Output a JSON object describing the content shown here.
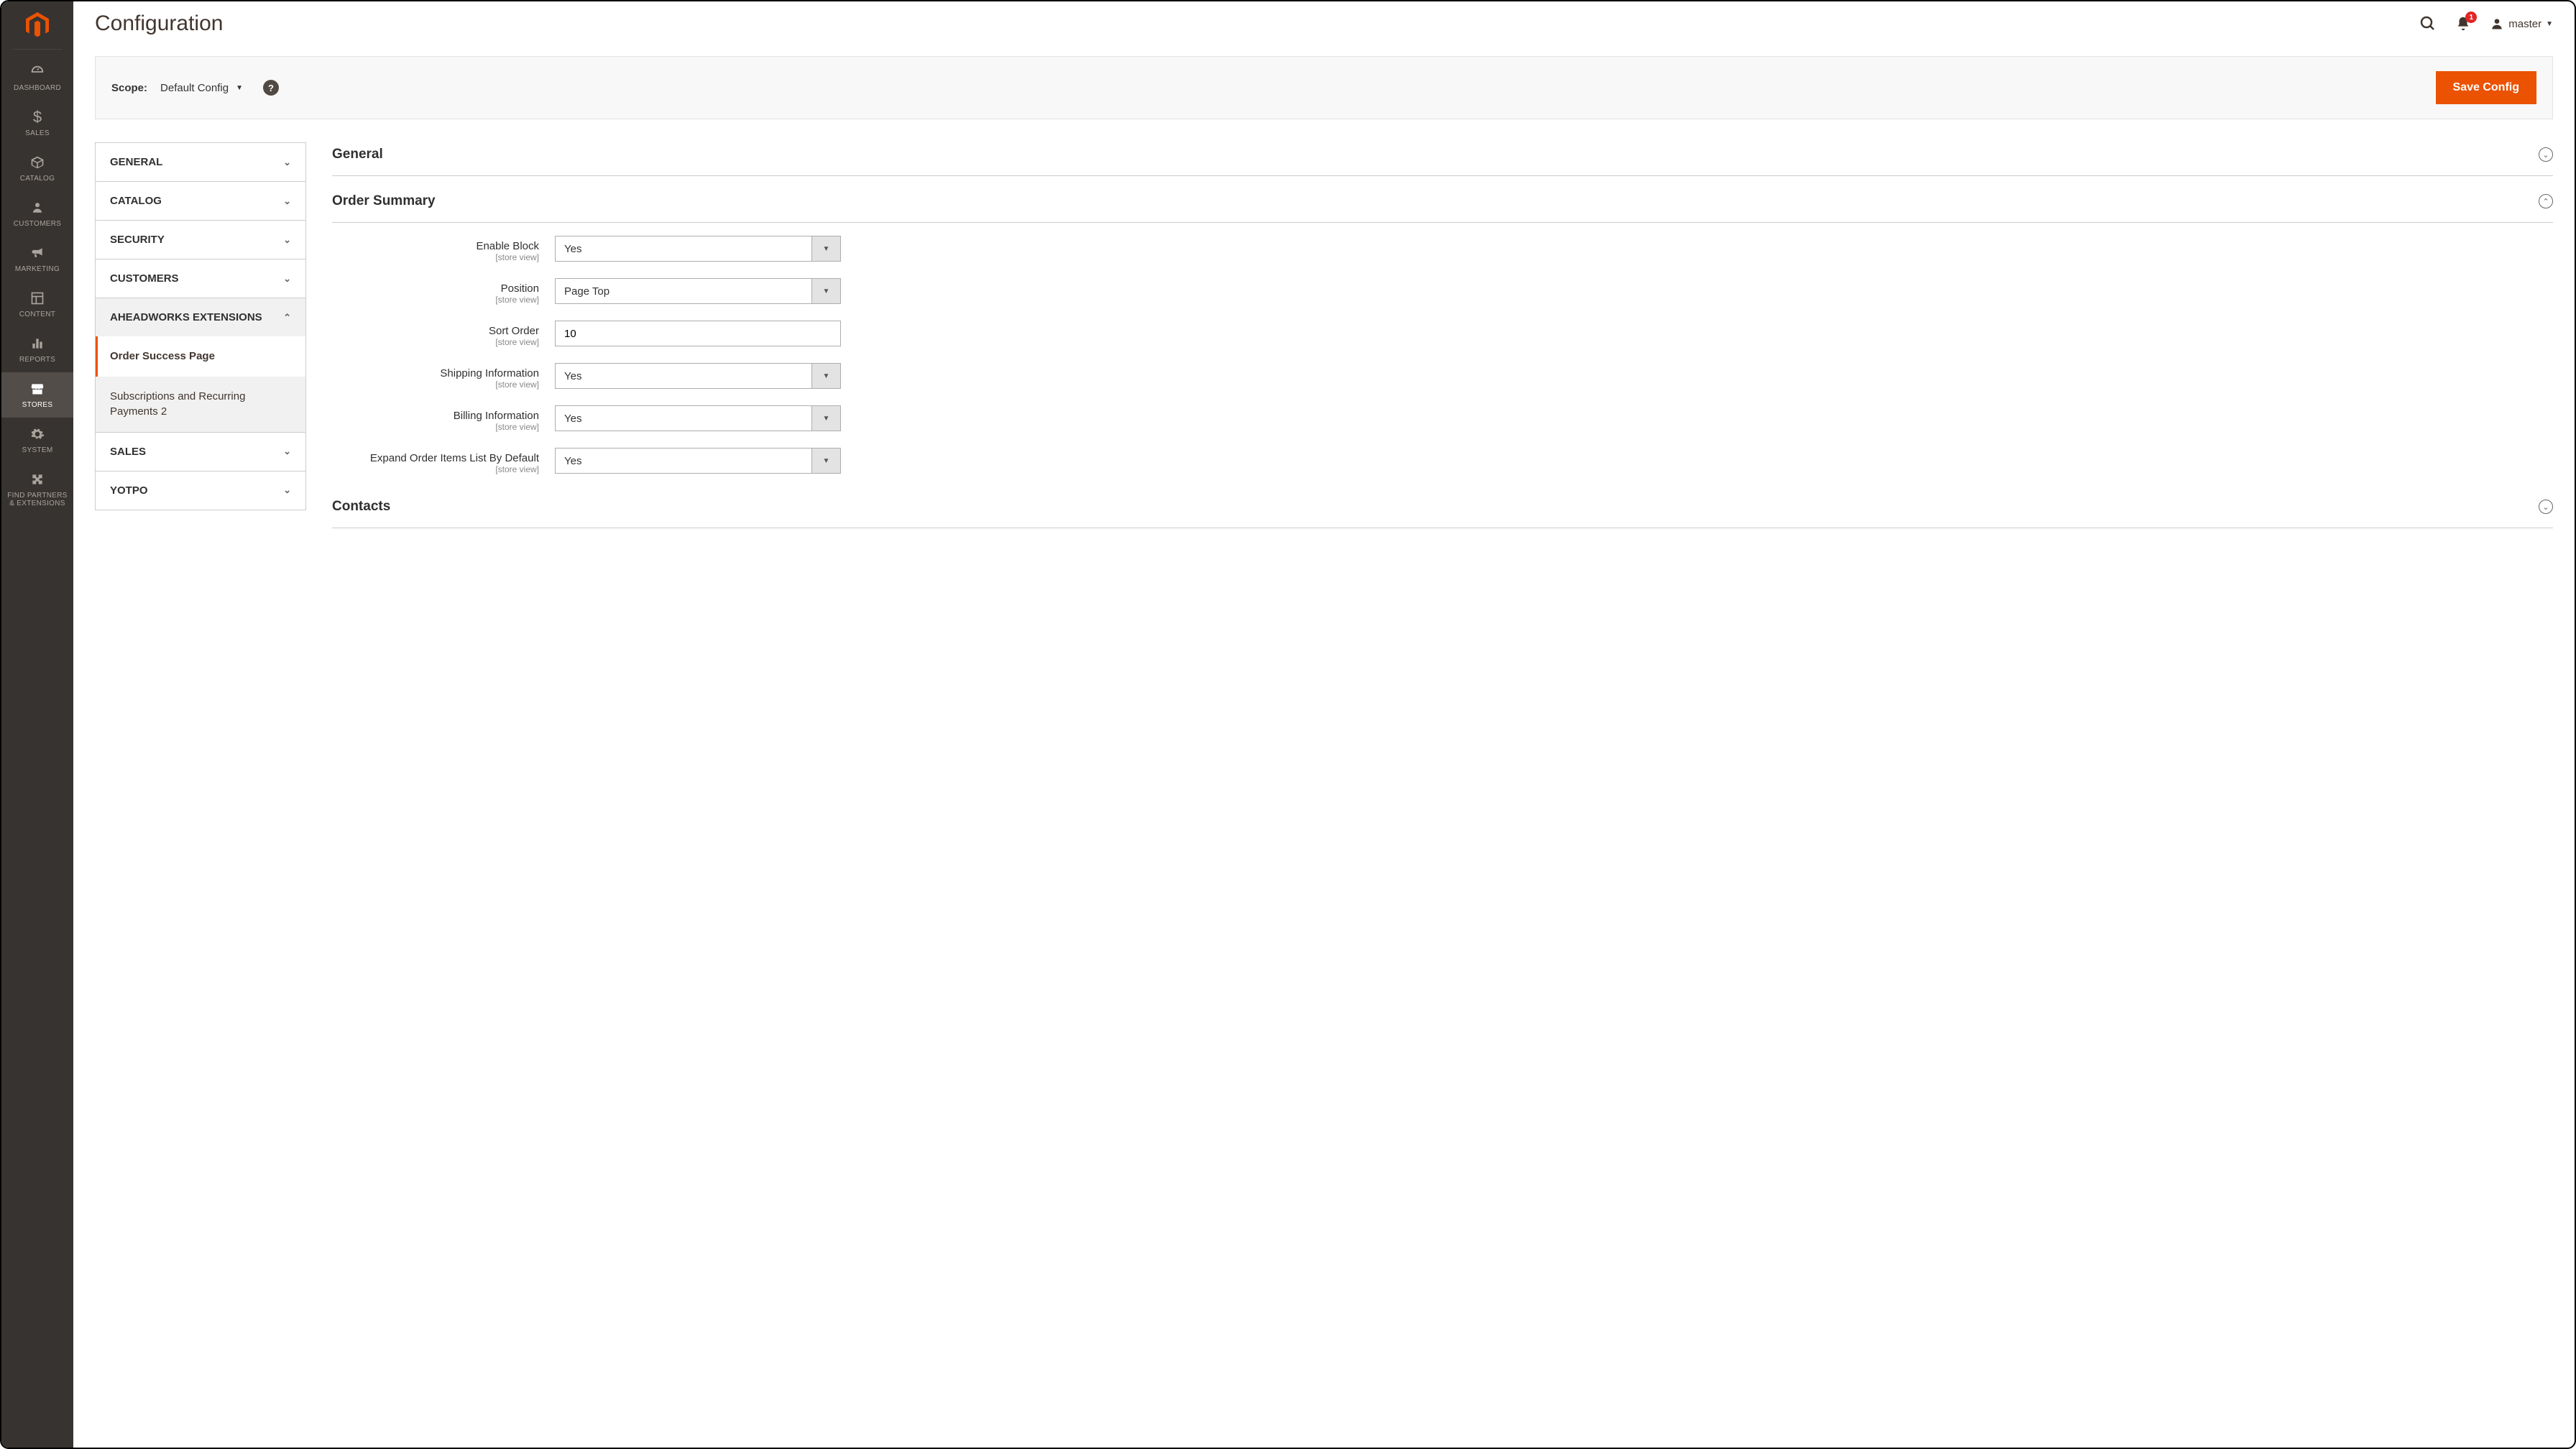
{
  "header": {
    "title": "Configuration",
    "notification_count": "1",
    "user_name": "master"
  },
  "scope": {
    "label": "Scope:",
    "value": "Default Config",
    "save_label": "Save Config"
  },
  "sidebar": {
    "items": [
      {
        "label": "DASHBOARD"
      },
      {
        "label": "SALES"
      },
      {
        "label": "CATALOG"
      },
      {
        "label": "CUSTOMERS"
      },
      {
        "label": "MARKETING"
      },
      {
        "label": "CONTENT"
      },
      {
        "label": "REPORTS"
      },
      {
        "label": "STORES"
      },
      {
        "label": "SYSTEM"
      },
      {
        "label": "FIND PARTNERS & EXTENSIONS"
      }
    ]
  },
  "config_nav": {
    "tabs": [
      {
        "label": "GENERAL"
      },
      {
        "label": "CATALOG"
      },
      {
        "label": "SECURITY"
      },
      {
        "label": "CUSTOMERS"
      },
      {
        "label": "AHEADWORKS EXTENSIONS"
      },
      {
        "label": "SALES"
      },
      {
        "label": "YOTPO"
      }
    ],
    "subitems": [
      {
        "label": "Order Success Page"
      },
      {
        "label": "Subscriptions and Recurring Payments 2"
      }
    ]
  },
  "sections": {
    "general": {
      "title": "General"
    },
    "order_summary": {
      "title": "Order Summary",
      "fields": {
        "enable_block": {
          "label": "Enable Block",
          "scope": "[store view]",
          "value": "Yes"
        },
        "position": {
          "label": "Position",
          "scope": "[store view]",
          "value": "Page Top"
        },
        "sort_order": {
          "label": "Sort Order",
          "scope": "[store view]",
          "value": "10"
        },
        "shipping_info": {
          "label": "Shipping Information",
          "scope": "[store view]",
          "value": "Yes"
        },
        "billing_info": {
          "label": "Billing Information",
          "scope": "[store view]",
          "value": "Yes"
        },
        "expand_items": {
          "label": "Expand Order Items List By Default",
          "scope": "[store view]",
          "value": "Yes"
        }
      }
    },
    "contacts": {
      "title": "Contacts"
    }
  }
}
